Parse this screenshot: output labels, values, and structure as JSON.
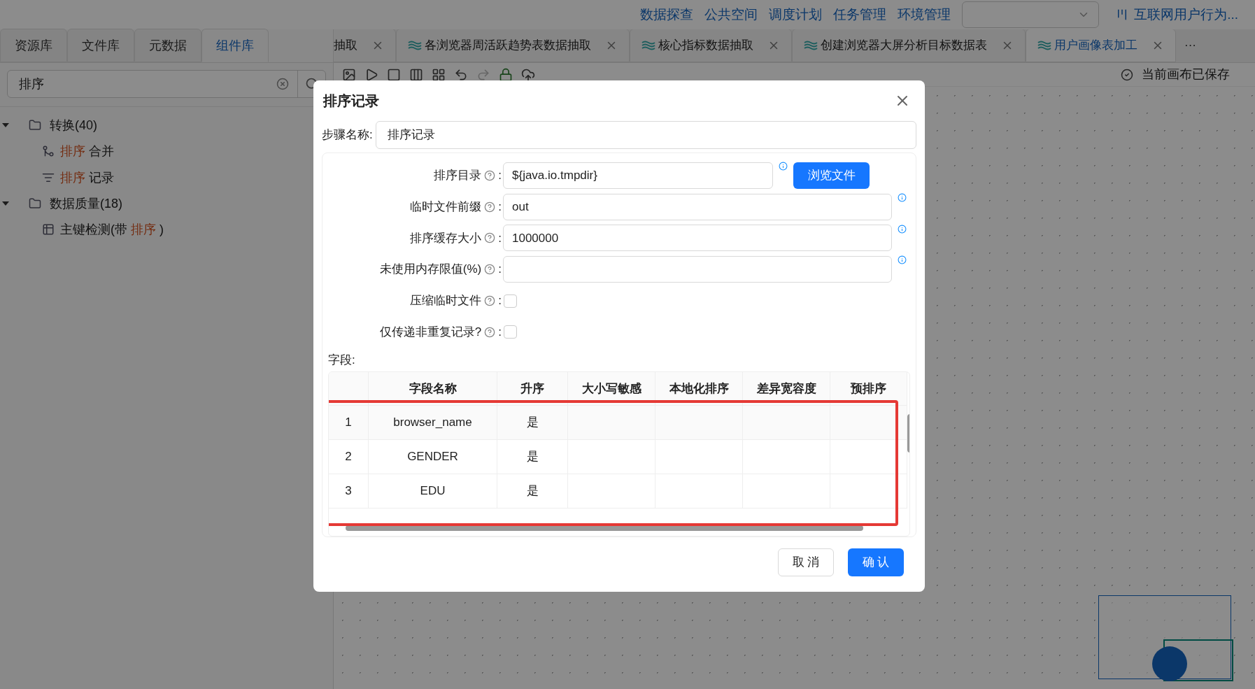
{
  "top_nav": {
    "links": [
      "数据探查",
      "公共空间",
      "调度计划",
      "任务管理",
      "环境管理"
    ],
    "project": "互联网用户行为..."
  },
  "left_tabs": [
    {
      "label": "资源库",
      "selected": false
    },
    {
      "label": "文件库",
      "selected": false
    },
    {
      "label": "元数据",
      "selected": false
    },
    {
      "label": "组件库",
      "selected": true
    }
  ],
  "search": {
    "value": "排序"
  },
  "tree": [
    {
      "label": "转换(40)",
      "expanded": true,
      "children": [
        {
          "kind": "merge",
          "parts": [
            {
              "text": "排序",
              "match": true
            },
            {
              "text": " 合并",
              "match": false
            }
          ]
        },
        {
          "kind": "sort",
          "parts": [
            {
              "text": "排序",
              "match": true
            },
            {
              "text": " 记录",
              "match": false
            }
          ]
        }
      ]
    },
    {
      "label": "数据质量(18)",
      "expanded": true,
      "children": [
        {
          "kind": "check",
          "parts": [
            {
              "text": "主键检测(带 ",
              "match": false
            },
            {
              "text": "排序",
              "match": true
            },
            {
              "text": " )",
              "match": false
            }
          ]
        }
      ]
    }
  ],
  "editor_tabs": [
    {
      "label": "抽取",
      "selected": false,
      "cut": true
    },
    {
      "label": "各浏览器周活跃趋势表数据抽取",
      "selected": false,
      "cut": false
    },
    {
      "label": "核心指标数据抽取",
      "selected": false,
      "cut": false
    },
    {
      "label": "创建浏览器大屏分析目标数据表",
      "selected": false,
      "cut": false
    },
    {
      "label": "用户画像表加工",
      "selected": true,
      "cut": false
    }
  ],
  "more": "···",
  "save_status": "当前画布已保存",
  "dialog": {
    "title": "排序记录",
    "step_name": {
      "label": "步骤名称:",
      "value": "排序记录"
    },
    "fields": [
      {
        "kind": "text",
        "label": "排序目录",
        "colon": ":",
        "value": "${java.io.tmpdir}",
        "button": "浏览文件"
      },
      {
        "kind": "text",
        "label": "临时文件前缀",
        "colon": ":",
        "value": "out"
      },
      {
        "kind": "text",
        "label": "排序缓存大小",
        "colon": ":",
        "value": "1000000"
      },
      {
        "kind": "text",
        "label": "未使用内存限值(%)",
        "colon": ":"
      },
      {
        "kind": "checkbox",
        "label": "压缩临时文件",
        "colon": ":",
        "checked": false
      },
      {
        "kind": "checkbox",
        "label": "仅传递非重复记录?",
        "colon": ":",
        "checked": false
      }
    ],
    "table": {
      "label": "字段:",
      "columns": [
        "字段名称",
        "升序",
        "大小写敏感",
        "本地化排序",
        "差异宽容度",
        "预排序"
      ],
      "rows": [
        {
          "index": "1",
          "name": "browser_name",
          "ascending": "是"
        },
        {
          "index": "2",
          "name": "GENDER",
          "ascending": "是"
        },
        {
          "index": "3",
          "name": "EDU",
          "ascending": "是"
        }
      ]
    },
    "buttons": [
      {
        "label": "取 消",
        "kind": "secondary"
      },
      {
        "label": "确 认",
        "kind": "primary"
      }
    ]
  }
}
